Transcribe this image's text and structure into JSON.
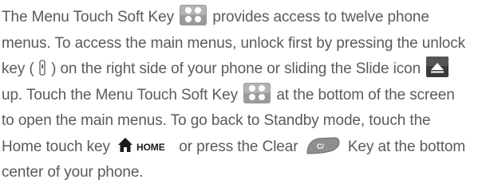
{
  "paragraph": {
    "line1": {
      "a": "The Menu Touch Soft Key",
      "b": "provides access to twelve phone"
    },
    "line2": "menus. To access the main menus, unlock first by pressing the unlock",
    "line3": {
      "a": "key (",
      "b": ") on the right side of your phone or sliding the Slide icon"
    },
    "line4": {
      "a": "up. Touch the Menu Touch Soft Key",
      "b": "at the bottom of the screen"
    },
    "line5": "to open the main menus. To go back to Standby mode, touch the",
    "line6": {
      "a": "Home touch key",
      "b": "or press the Clear",
      "c": "Key at the bottom"
    },
    "line7": "center of your phone."
  },
  "icons": {
    "menu_key": "menu-grid-icon",
    "unlock_key": "unlock-key-icon",
    "slide": "slide-up-icon",
    "home_key": "home-key-icon",
    "home_key_label": "HOME",
    "clear_key": "clear-key-icon",
    "clear_key_label": "C/"
  },
  "colors": {
    "text": "#5a5a5a",
    "menu_icon_bg": "#9a9a9a",
    "slide_icon_bg": "#3a3a3a"
  }
}
